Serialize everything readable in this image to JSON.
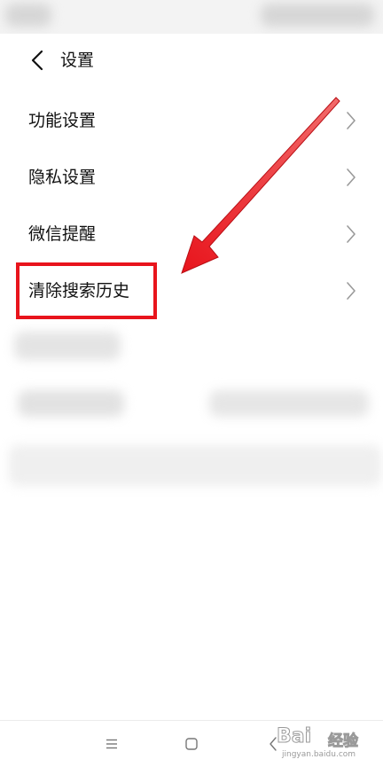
{
  "header": {
    "back_icon": "chevron-left-icon",
    "title": "设置"
  },
  "menu": {
    "items": [
      {
        "label": "功能设置",
        "icon": "chevron-right-icon"
      },
      {
        "label": "隐私设置",
        "icon": "chevron-right-icon"
      },
      {
        "label": "微信提醒",
        "icon": "chevron-right-icon"
      },
      {
        "label": "清除搜索历史",
        "icon": "chevron-right-icon"
      }
    ]
  },
  "annotation": {
    "highlight_color": "#e8141c",
    "arrow_color": "#e8141c",
    "highlighted_item": "清除搜索历史"
  },
  "nav_bar": {
    "menu_icon": "menu-icon",
    "home_icon": "square-home-icon",
    "back_icon": "chevron-left-icon"
  },
  "watermark": {
    "logo": "Bai",
    "sub": "经验",
    "url": "jingyan.baidu.com"
  },
  "colors": {
    "background": "#ffffff",
    "status_bar": "#f3f3f3",
    "text": "#111111",
    "chevron": "#9a9a9a"
  }
}
